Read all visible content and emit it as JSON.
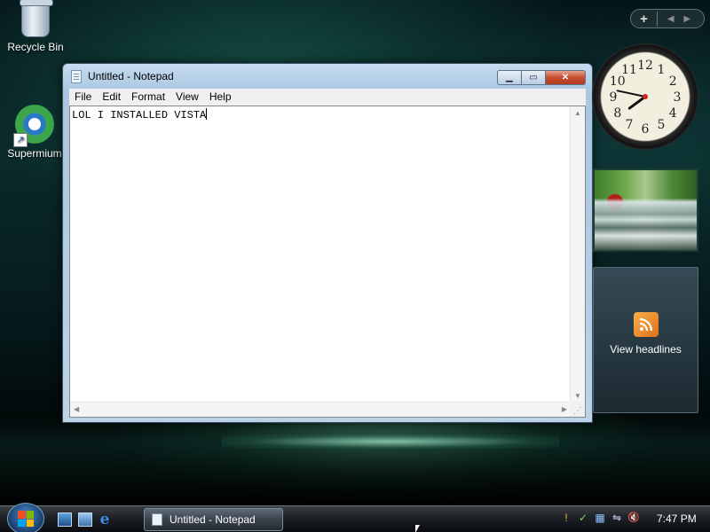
{
  "desktop": {
    "icons": [
      {
        "label": "Recycle Bin",
        "icon": "recycle-bin-icon"
      },
      {
        "label": "Supermium",
        "icon": "supermium-browser-icon"
      }
    ]
  },
  "notepad": {
    "title": "Untitled - Notepad",
    "menu": [
      "File",
      "Edit",
      "Format",
      "View",
      "Help"
    ],
    "content": "LOL I INSTALLED VISTA",
    "controls": {
      "minimize": "minimize-icon",
      "maximize": "maximize-icon",
      "close": "close-icon"
    }
  },
  "sidebar": {
    "toolbar": {
      "add": "+",
      "nav": "◀ ▶"
    },
    "clock": {
      "numerals": [
        "12",
        "1",
        "2",
        "3",
        "4",
        "5",
        "6",
        "7",
        "8",
        "9",
        "10",
        "11"
      ],
      "time": "7:47"
    },
    "feed": {
      "label": "View headlines",
      "icon": "rss-feed-icon"
    }
  },
  "taskbar": {
    "start": "start-orb",
    "quick_launch": [
      "show-desktop-icon",
      "switch-windows-icon",
      "internet-explorer-icon"
    ],
    "ie_glyph": "e",
    "task_button": "Untitled - Notepad",
    "tray": [
      "security-shield-icon",
      "network-icon",
      "wmp-icon",
      "network-status-icon",
      "volume-muted-icon"
    ],
    "tray_glyphs": [
      "!",
      "✓",
      "▦",
      "⇋",
      "🔇"
    ],
    "time": "7:47 PM"
  },
  "colors": {
    "accent": "#1d5fa8",
    "close": "#c44c2e",
    "rss": "#e0701a"
  }
}
